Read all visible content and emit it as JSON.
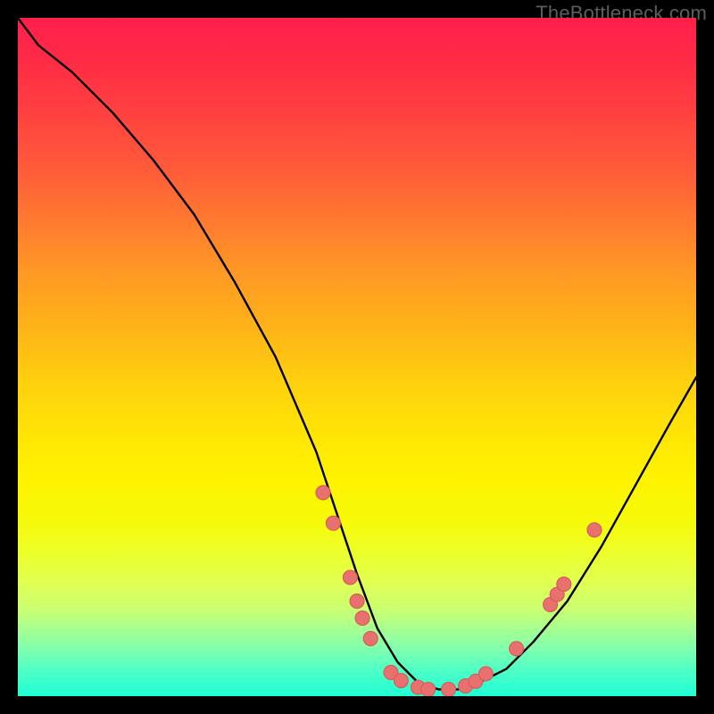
{
  "watermark": "TheBottleneck.com",
  "chart_data": {
    "type": "line",
    "title": "",
    "xlabel": "",
    "ylabel": "",
    "xlim": [
      0,
      100
    ],
    "ylim": [
      0,
      100
    ],
    "series": [
      {
        "name": "curve",
        "x": [
          0,
          3,
          8,
          14,
          20,
          26,
          32,
          38,
          44,
          47,
          50,
          53,
          56,
          59,
          62,
          65,
          68,
          72,
          76,
          81,
          86,
          91,
          96,
          100
        ],
        "y": [
          100,
          96,
          92,
          86,
          79,
          71,
          61,
          50,
          36,
          27,
          18,
          10,
          5,
          2,
          1,
          1,
          2,
          4,
          8,
          14,
          22,
          31,
          40,
          47
        ]
      }
    ],
    "markers": [
      {
        "x": 45.0,
        "y": 30.0
      },
      {
        "x": 46.5,
        "y": 25.5
      },
      {
        "x": 49.0,
        "y": 17.5
      },
      {
        "x": 50.0,
        "y": 14.0
      },
      {
        "x": 50.8,
        "y": 11.5
      },
      {
        "x": 52.0,
        "y": 8.5
      },
      {
        "x": 55.0,
        "y": 3.5
      },
      {
        "x": 56.5,
        "y": 2.3
      },
      {
        "x": 59.0,
        "y": 1.3
      },
      {
        "x": 60.5,
        "y": 1.0
      },
      {
        "x": 63.5,
        "y": 1.0
      },
      {
        "x": 66.0,
        "y": 1.5
      },
      {
        "x": 67.5,
        "y": 2.2
      },
      {
        "x": 69.0,
        "y": 3.3
      },
      {
        "x": 73.5,
        "y": 7.0
      },
      {
        "x": 78.5,
        "y": 13.5
      },
      {
        "x": 79.5,
        "y": 15.0
      },
      {
        "x": 80.5,
        "y": 16.5
      },
      {
        "x": 85.0,
        "y": 24.5
      }
    ],
    "colors": {
      "curve": "#000000",
      "marker_fill": "#e8716f",
      "marker_stroke": "#d85a58"
    }
  }
}
